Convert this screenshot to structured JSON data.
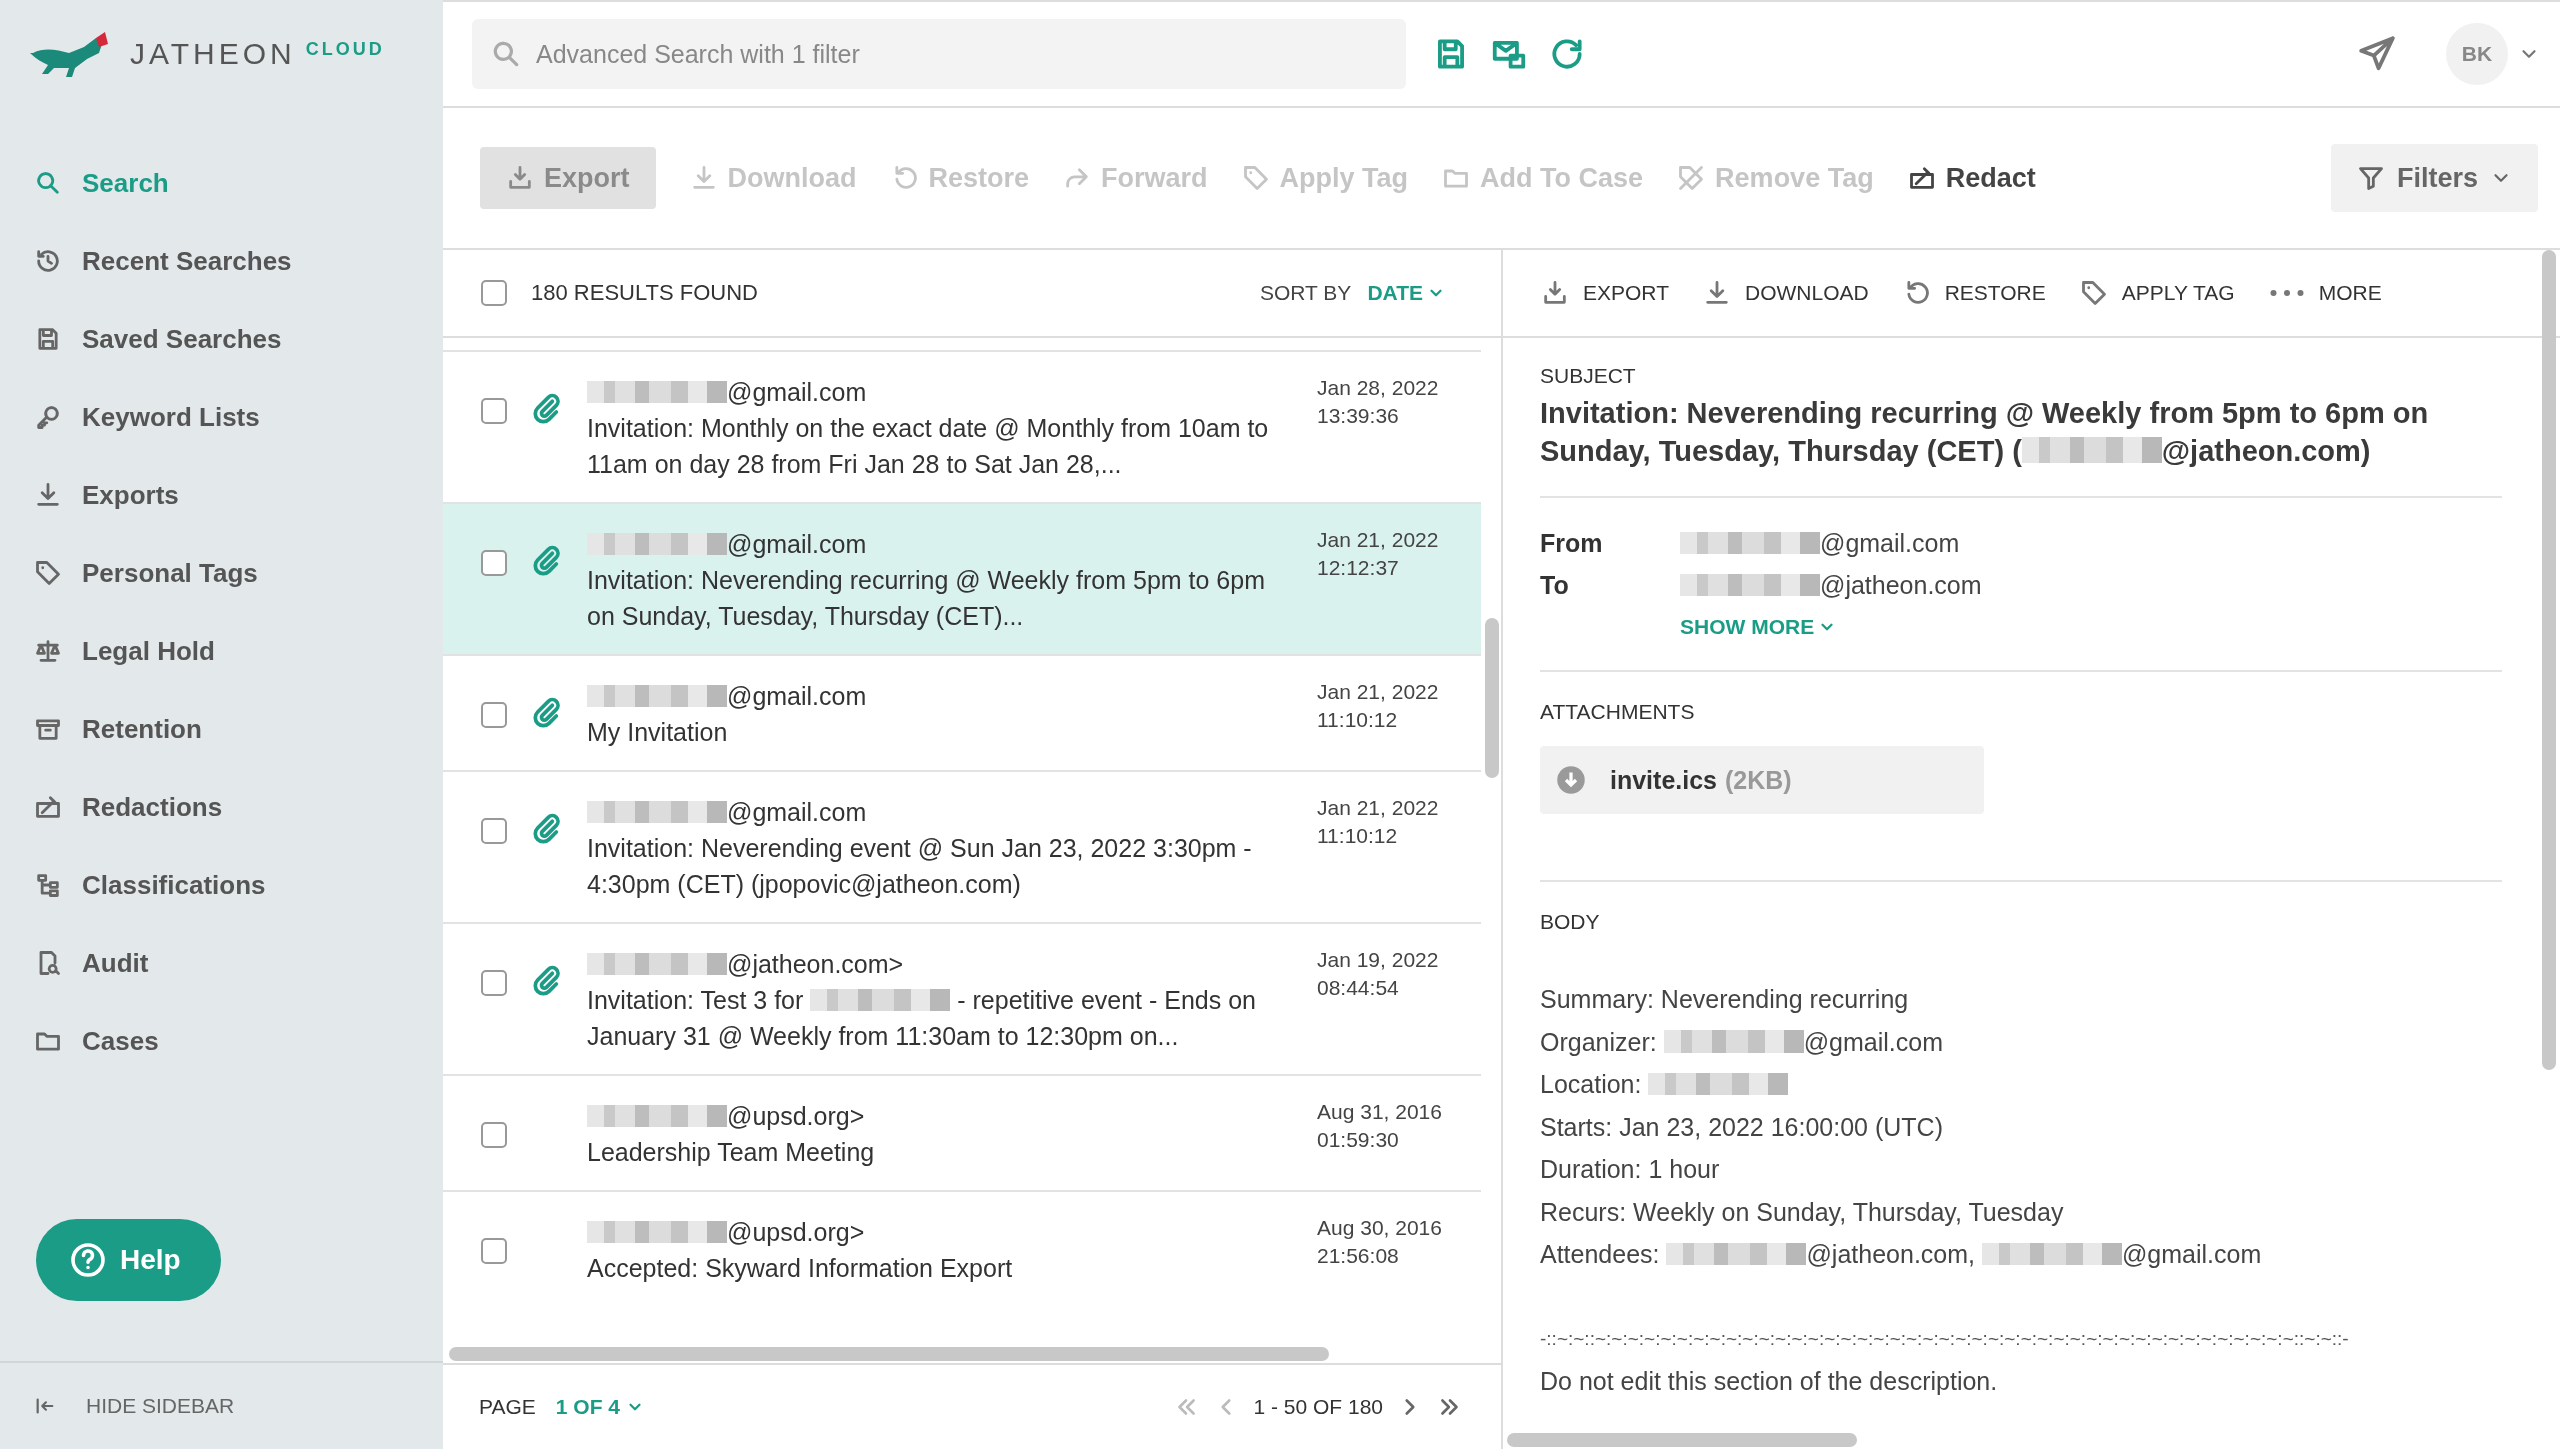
{
  "brand": {
    "name": "JATHEON",
    "suffix": "CLOUD"
  },
  "sidebar": {
    "items": [
      {
        "label": "Search",
        "selected": true
      },
      {
        "label": "Recent Searches",
        "selected": false
      },
      {
        "label": "Saved Searches",
        "selected": false
      },
      {
        "label": "Keyword Lists",
        "selected": false
      },
      {
        "label": "Exports",
        "selected": false
      },
      {
        "label": "Personal Tags",
        "selected": false
      },
      {
        "label": "Legal Hold",
        "selected": false
      },
      {
        "label": "Retention",
        "selected": false
      },
      {
        "label": "Redactions",
        "selected": false
      },
      {
        "label": "Classifications",
        "selected": false
      },
      {
        "label": "Audit",
        "selected": false
      },
      {
        "label": "Cases",
        "selected": false
      }
    ],
    "help": "Help",
    "hide": "HIDE SIDEBAR"
  },
  "search": {
    "placeholder": "Advanced Search with 1 filter"
  },
  "user": {
    "initials": "BK"
  },
  "toolbar": {
    "actions": [
      {
        "label": "Export",
        "kind": "boxed",
        "disabled": true
      },
      {
        "label": "Download",
        "kind": "plain",
        "disabled": true
      },
      {
        "label": "Restore",
        "kind": "plain",
        "disabled": true
      },
      {
        "label": "Forward",
        "kind": "plain",
        "disabled": true
      },
      {
        "label": "Apply Tag",
        "kind": "plain",
        "disabled": true
      },
      {
        "label": "Add To Case",
        "kind": "plain",
        "disabled": true
      },
      {
        "label": "Remove Tag",
        "kind": "plain",
        "disabled": true
      },
      {
        "label": "Redact",
        "kind": "plain",
        "disabled": false
      }
    ],
    "filters": "Filters"
  },
  "results": {
    "select_all": {
      "checked": false
    },
    "count": "180 RESULTS FOUND",
    "sort_label": "SORT BY",
    "sort_value": "DATE",
    "rows": [
      {
        "sender": [
          {
            "kind": "redacted"
          },
          {
            "kind": "text",
            "text": "@gmail.com"
          }
        ],
        "subject": [
          {
            "kind": "text",
            "text": "Invitation: Monthly on the exact date @ Monthly from 10am to 11am on day 28 from Fri Jan 28 to Sat Jan 28,..."
          }
        ],
        "date": "Jan 28, 2022",
        "time": "13:39:36",
        "attachment": true,
        "checked": false,
        "selected": false
      },
      {
        "sender": [
          {
            "kind": "redacted"
          },
          {
            "kind": "text",
            "text": "@gmail.com"
          }
        ],
        "subject": [
          {
            "kind": "text",
            "text": "Invitation: Neverending recurring @ Weekly from 5pm to 6pm on Sunday, Tuesday, Thursday (CET)..."
          }
        ],
        "date": "Jan 21, 2022",
        "time": "12:12:37",
        "attachment": true,
        "checked": false,
        "selected": true
      },
      {
        "sender": [
          {
            "kind": "redacted"
          },
          {
            "kind": "text",
            "text": "@gmail.com"
          }
        ],
        "subject": [
          {
            "kind": "text",
            "text": "My Invitation"
          }
        ],
        "date": "Jan 21, 2022",
        "time": "11:10:12",
        "attachment": true,
        "checked": false,
        "selected": false
      },
      {
        "sender": [
          {
            "kind": "redacted"
          },
          {
            "kind": "text",
            "text": "@gmail.com"
          }
        ],
        "subject": [
          {
            "kind": "text",
            "text": "Invitation: Neverending event @ Sun Jan 23, 2022 3:30pm - 4:30pm (CET) (jpopovic@jatheon.com)"
          }
        ],
        "date": "Jan 21, 2022",
        "time": "11:10:12",
        "attachment": true,
        "checked": false,
        "selected": false
      },
      {
        "sender": [
          {
            "kind": "redacted"
          },
          {
            "kind": "text",
            "text": "@jatheon.com>"
          }
        ],
        "subject": [
          {
            "kind": "text",
            "text": "Invitation: Test 3 for "
          },
          {
            "kind": "redacted"
          },
          {
            "kind": "text",
            "text": " - repetitive event - Ends on January 31 @ Weekly from 11:30am to 12:30pm on..."
          }
        ],
        "date": "Jan 19, 2022",
        "time": "08:44:54",
        "attachment": true,
        "checked": false,
        "selected": false
      },
      {
        "sender": [
          {
            "kind": "redacted"
          },
          {
            "kind": "text",
            "text": "@upsd.org>"
          }
        ],
        "subject": [
          {
            "kind": "text",
            "text": "Leadership Team Meeting"
          }
        ],
        "date": "Aug 31, 2016",
        "time": "01:59:30",
        "attachment": false,
        "checked": false,
        "selected": false
      },
      {
        "sender": [
          {
            "kind": "redacted"
          },
          {
            "kind": "text",
            "text": "@upsd.org>"
          }
        ],
        "subject": [
          {
            "kind": "text",
            "text": "Accepted: Skyward Information Export"
          }
        ],
        "date": "Aug 30, 2016",
        "time": "21:56:08",
        "attachment": false,
        "checked": false,
        "selected": false
      }
    ],
    "page_label": "PAGE",
    "page_value": "1 OF 4",
    "range": "1 - 50 OF 180"
  },
  "detail": {
    "actions": [
      "EXPORT",
      "DOWNLOAD",
      "RESTORE",
      "APPLY TAG",
      "MORE"
    ],
    "subject_label": "SUBJECT",
    "subject": [
      {
        "kind": "text",
        "text": "Invitation: Neverending recurring @ Weekly from 5pm to 6pm on Sunday, Tuesday, Thursday (CET) ("
      },
      {
        "kind": "redacted"
      },
      {
        "kind": "text",
        "text": "@jatheon.com)"
      }
    ],
    "fields": [
      {
        "label": "From",
        "value": [
          {
            "kind": "redacted"
          },
          {
            "kind": "text",
            "text": "@gmail.com"
          }
        ]
      },
      {
        "label": "To",
        "value": [
          {
            "kind": "redacted"
          },
          {
            "kind": "text",
            "text": "@jatheon.com"
          }
        ]
      }
    ],
    "show_more": "SHOW MORE",
    "attachments_label": "ATTACHMENTS",
    "attachment": {
      "name": "invite.ics",
      "size": "(2KB)"
    },
    "body_label": "BODY",
    "body": [
      [
        {
          "kind": "text",
          "text": "Summary: Neverending recurring"
        }
      ],
      [
        {
          "kind": "text",
          "text": "Organizer: "
        },
        {
          "kind": "redacted"
        },
        {
          "kind": "text",
          "text": "@gmail.com"
        }
      ],
      [
        {
          "kind": "text",
          "text": "Location: "
        },
        {
          "kind": "redacted"
        }
      ],
      [
        {
          "kind": "text",
          "text": "Starts: Jan 23, 2022 16:00:00 (UTC)"
        }
      ],
      [
        {
          "kind": "text",
          "text": "Duration: 1 hour"
        }
      ],
      [
        {
          "kind": "text",
          "text": "Recurs: Weekly on Sunday, Thursday, Tuesday"
        }
      ],
      [
        {
          "kind": "text",
          "text": "Attendees: "
        },
        {
          "kind": "redacted"
        },
        {
          "kind": "text",
          "text": "@jatheon.com, "
        },
        {
          "kind": "redacted"
        },
        {
          "kind": "text",
          "text": "@gmail.com"
        }
      ]
    ],
    "separator": "-::~:~::~:~:~:~:~:~:~:~:~:~:~:~:~:~:~:~:~:~:~:~:~:~:~:~:~:~:~:~:~:~:~:~:~:~:~:~:~:~:~:~:~:~:~::~:~::-",
    "note": "Do not edit this section of the description."
  }
}
